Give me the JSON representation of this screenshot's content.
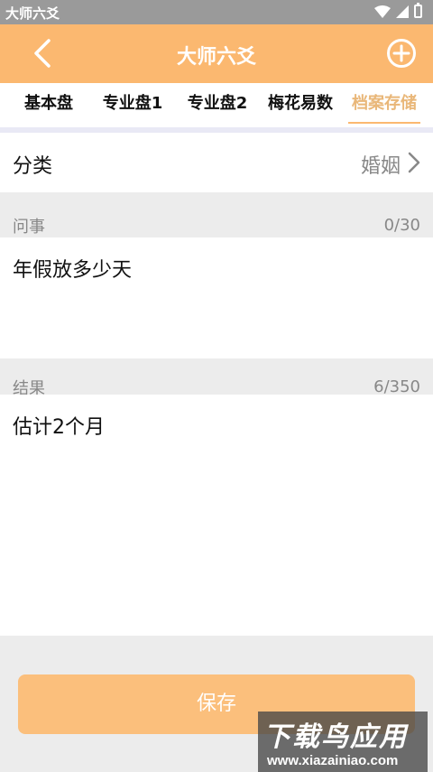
{
  "status_bar": {
    "app_name": "大师六爻"
  },
  "nav": {
    "title": "大师六爻"
  },
  "tabs": [
    {
      "label": "基本盘",
      "active": false
    },
    {
      "label": "专业盘1",
      "active": false
    },
    {
      "label": "专业盘2",
      "active": false
    },
    {
      "label": "梅花易数",
      "active": false
    },
    {
      "label": "档案存储",
      "active": true
    }
  ],
  "category": {
    "label": "分类",
    "value": "婚姻"
  },
  "question": {
    "label": "问事",
    "count": "0/30",
    "text": "年假放多少天"
  },
  "result": {
    "label": "结果",
    "count": "6/350",
    "text": "估计2个月"
  },
  "save_label": "保存",
  "watermark": {
    "title": "下载鸟应用",
    "url": "www.xiazainiao.com"
  },
  "colors": {
    "accent": "#fbb870",
    "active_tab": "#e9b779",
    "status_bar": "#9a9a9a"
  }
}
